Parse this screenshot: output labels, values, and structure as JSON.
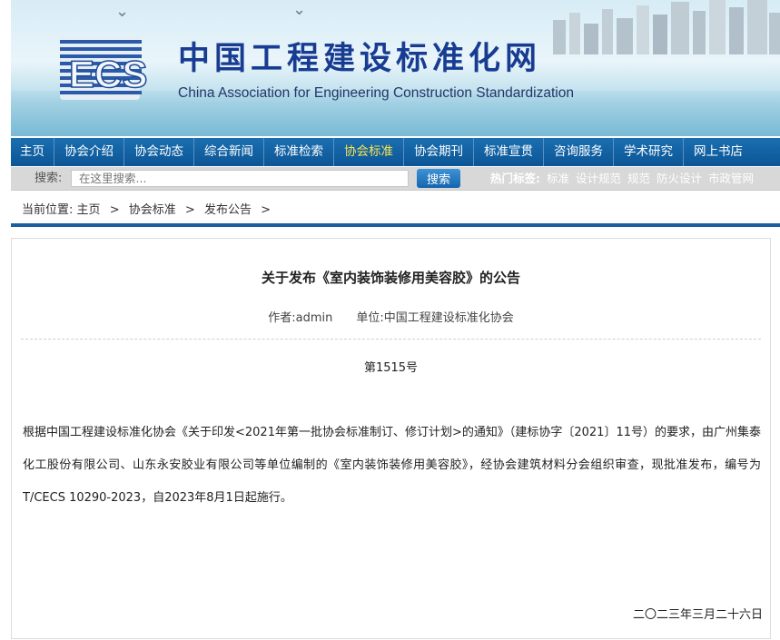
{
  "header": {
    "title_cn": "中国工程建设标准化网",
    "title_en": "China Association for Engineering Construction Standardization",
    "logo_text": "ECS",
    "logo_icon": "ecs-logo",
    "colors": {
      "brand_blue": "#173c92",
      "nav_blue": "#0c5596",
      "accent_yellow": "#ffe44d"
    }
  },
  "nav": {
    "items": [
      "主页",
      "协会介绍",
      "协会动态",
      "综合新闻",
      "标准检索",
      "协会标准",
      "协会期刊",
      "标准宣贯",
      "咨询服务",
      "学术研究",
      "网上书店"
    ],
    "active": "协会标准"
  },
  "search": {
    "label": "搜索:",
    "placeholder": "在这里搜索...",
    "button": "搜索",
    "hot_label": "热门标签:",
    "hot_tags": [
      "标准",
      "设计规范",
      "规范",
      "防火设计",
      "市政管网"
    ]
  },
  "breadcrumb": {
    "prefix": "当前位置:",
    "items": [
      "主页",
      "协会标准",
      "发布公告"
    ],
    "separator": ">"
  },
  "article": {
    "title": "关于发布《室内装饰装修用美容胶》的公告",
    "author": "作者:admin",
    "unit": "单位:中国工程建设标准化协会",
    "doc_no": "第1515号",
    "body": "根据中国工程建设标准化协会《关于印发<2021年第一批协会标准制订、修订计划>的通知》（建标协字〔2021〕11号）的要求，由广州集泰化工股份有限公司、山东永安胶业有限公司等单位编制的《室内装饰装修用美容胶》，经协会建筑材料分会组织审查，现批准发布，编号为T/CECS 10290-2023，自2023年8月1日起施行。",
    "date": "二〇二三年三月二十六日"
  }
}
